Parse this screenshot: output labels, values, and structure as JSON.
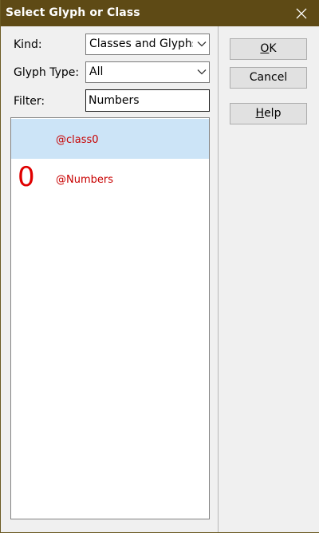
{
  "window": {
    "title": "Select Glyph or Class"
  },
  "form": {
    "kind_label": "Kind:",
    "kind_value": "Classes and Glyphs",
    "glyph_type_label": "Glyph Type:",
    "glyph_type_value": "All",
    "filter_label": "Filter:",
    "filter_value": "Numbers"
  },
  "list": {
    "items": [
      {
        "glyph": "",
        "name": "@class0",
        "selected": true
      },
      {
        "glyph": "0",
        "name": "@Numbers",
        "selected": false
      }
    ]
  },
  "buttons": {
    "ok_mnemonic": "O",
    "ok_rest": "K",
    "cancel": "Cancel",
    "help_mnemonic": "H",
    "help_rest": "elp"
  },
  "colors": {
    "titlebar": "#5e4a15",
    "selection": "#cce4f7",
    "item_text": "#c80000"
  },
  "icons": {
    "close": "close-icon",
    "dropdown": "chevron-down-icon"
  }
}
